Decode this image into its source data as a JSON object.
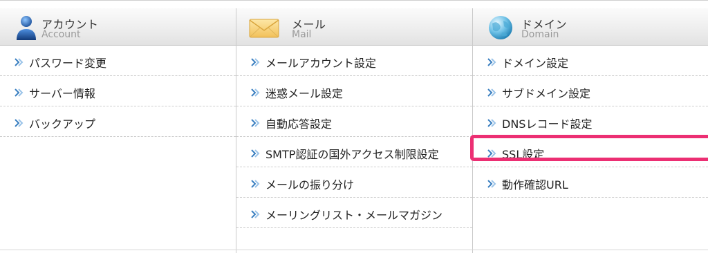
{
  "columns": [
    {
      "title": "アカウント",
      "subtitle": "Account",
      "icon": "account-icon",
      "items": [
        "パスワード変更",
        "サーバー情報",
        "バックアップ"
      ]
    },
    {
      "title": "メール",
      "subtitle": "Mail",
      "icon": "mail-envelope-icon",
      "items": [
        "メールアカウント設定",
        "迷惑メール設定",
        "自動応答設定",
        "SMTP認証の国外アクセス制限設定",
        "メールの振り分け",
        "メーリングリスト・メールマガジン"
      ]
    },
    {
      "title": "ドメイン",
      "subtitle": "Domain",
      "icon": "domain-globe-icon",
      "items": [
        "ドメイン設定",
        "サブドメイン設定",
        "DNSレコード設定",
        "SSL設定",
        "動作確認URL"
      ]
    }
  ],
  "highlighted_item": "SSL設定",
  "colors": {
    "highlight_border": "#ec2f73",
    "arrow": "#3a7fc0",
    "header_bg": "#eeeeee"
  }
}
